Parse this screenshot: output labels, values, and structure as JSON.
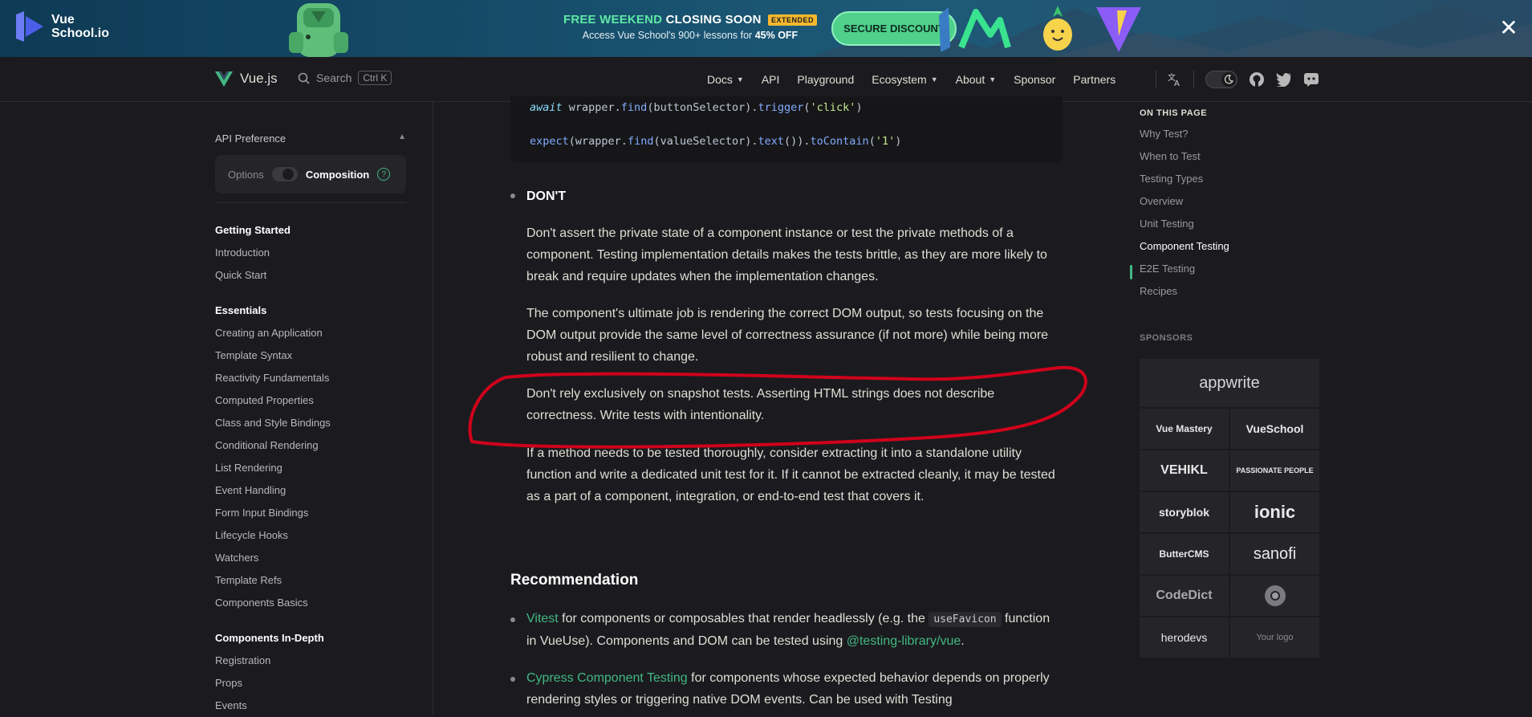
{
  "banner": {
    "brand_line1": "Vue",
    "brand_line2": "School.io",
    "promo_free": "FREE WEEKEND",
    "promo_closing": "CLOSING SOON",
    "promo_badge": "EXTENDED",
    "promo_sub_prefix": "Access Vue School's 900+ lessons for",
    "promo_sub_bold": "45% OFF",
    "cta": "SECURE DISCOUNT",
    "close": "✕"
  },
  "nav": {
    "brand": "Vue.js",
    "search": "Search",
    "shortcut": "Ctrl K",
    "links": [
      "Docs",
      "API",
      "Playground",
      "Ecosystem",
      "About",
      "Sponsor",
      "Partners"
    ]
  },
  "sidebar": {
    "api_pref": "API Preference",
    "options": "Options",
    "composition": "Composition",
    "help": "?",
    "groups": [
      {
        "title": "Getting Started",
        "items": [
          "Introduction",
          "Quick Start"
        ]
      },
      {
        "title": "Essentials",
        "items": [
          "Creating an Application",
          "Template Syntax",
          "Reactivity Fundamentals",
          "Computed Properties",
          "Class and Style Bindings",
          "Conditional Rendering",
          "List Rendering",
          "Event Handling",
          "Form Input Bindings",
          "Lifecycle Hooks",
          "Watchers",
          "Template Refs",
          "Components Basics"
        ]
      },
      {
        "title": "Components In-Depth",
        "items": [
          "Registration",
          "Props",
          "Events"
        ]
      }
    ]
  },
  "code": {
    "line1_kw": "await",
    "line1_a": " wrapper.",
    "line1_fn1": "find",
    "line1_b": "(buttonSelector).",
    "line1_fn2": "trigger",
    "line1_c": "(",
    "line1_str": "'click'",
    "line1_d": ")",
    "line2_fn1": "expect",
    "line2_a": "(wrapper.",
    "line2_fn2": "find",
    "line2_b": "(valueSelector).",
    "line2_fn3": "text",
    "line2_c": "()).",
    "line2_fn4": "toContain",
    "line2_d": "(",
    "line2_str": "'1'",
    "line2_e": ")"
  },
  "content": {
    "dont": "DON'T",
    "p1": "Don't assert the private state of a component instance or test the private methods of a component. Testing implementation details makes the tests brittle, as they are more likely to break and require updates when the implementation changes.",
    "p2": "The component's ultimate job is rendering the correct DOM output, so tests focusing on the DOM output provide the same level of correctness assurance (if not more) while being more robust and resilient to change.",
    "p3": "Don't rely exclusively on snapshot tests. Asserting HTML strings does not describe correctness. Write tests with intentionality.",
    "p4": "If a method needs to be tested thoroughly, consider extracting it into a standalone utility function and write a dedicated unit test for it. If it cannot be extracted cleanly, it may be tested as a part of a component, integration, or end-to-end test that covers it.",
    "recommendation": "Recommendation",
    "r1_link": "Vitest",
    "r1_a": " for components or composables that render headlessly (e.g. the ",
    "r1_code": "useFavicon",
    "r1_b": " function in VueUse). Components and DOM can be tested using ",
    "r1_link2": "@testing-library/vue",
    "r1_c": ".",
    "r2_link": "Cypress Component Testing",
    "r2_a": " for components whose expected behavior depends on properly rendering styles or triggering native DOM events. Can be used with Testing"
  },
  "aside": {
    "toc_title": "ON THIS PAGE",
    "toc": [
      "Why Test?",
      "When to Test",
      "Testing Types",
      "Overview",
      "Unit Testing",
      "Component Testing",
      "E2E Testing",
      "Recipes"
    ],
    "active_index": 5,
    "sponsors_title": "SPONSORS",
    "sponsors": [
      "appwrite",
      "Vue Mastery",
      "VueSchool",
      "VEHIKL",
      "PASSIONATE PEOPLE",
      "storyblok",
      "ionic",
      "ButterCMS",
      "sanofi",
      "CodeDict",
      "",
      "herodevs",
      "Your logo"
    ]
  },
  "colors": {
    "accent": "#42b883",
    "annotation": "#d0021b",
    "background": "#1b1b1f"
  }
}
